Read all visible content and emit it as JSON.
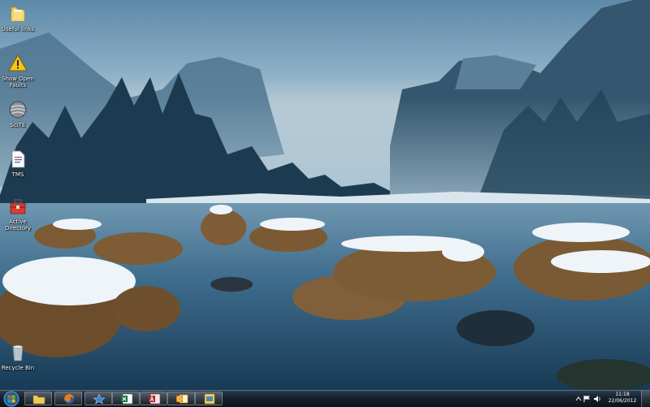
{
  "desktop": {
    "icons": [
      {
        "label": "Useful links",
        "icon": "folder-icon"
      },
      {
        "label": "Show Open Faults",
        "icon": "warning-icon"
      },
      {
        "label": "SciTE",
        "icon": "scite-icon"
      },
      {
        "label": "TMS",
        "icon": "document-icon"
      },
      {
        "label": "Active Directory",
        "icon": "toolbox-icon"
      },
      {
        "label": "Recycle Bin",
        "icon": "recycle-bin-icon"
      }
    ]
  },
  "taskbar": {
    "pinned": [
      {
        "name": "Windows Explorer",
        "icon": "explorer-icon"
      },
      {
        "name": "Firefox",
        "icon": "firefox-icon"
      },
      {
        "name": "Paint",
        "icon": "paint-icon"
      },
      {
        "name": "Excel",
        "icon": "excel-icon"
      },
      {
        "name": "Access",
        "icon": "access-icon"
      },
      {
        "name": "Outlook",
        "icon": "outlook-icon"
      },
      {
        "name": "Notes",
        "icon": "notes-icon"
      }
    ],
    "clock": {
      "time": "11:18",
      "date": "22/06/2012"
    }
  }
}
